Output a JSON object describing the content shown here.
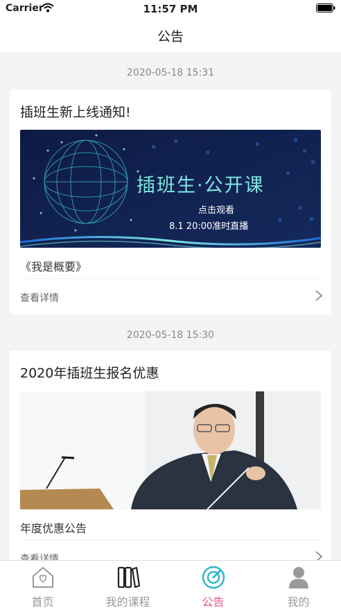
{
  "status_bar": {
    "carrier": "Carrier",
    "time": "11:57 PM"
  },
  "nav": {
    "title": "公告"
  },
  "colors": {
    "accent": "#e8547f",
    "active_icon": "#2bb7c8",
    "inactive": "#999999"
  },
  "announcements": [
    {
      "timestamp": "2020-05-18 15:31",
      "title": "插班生新上线通知!",
      "banner": {
        "line1": "插班生·公开课",
        "line2": "点击观看",
        "line3": "8.1 20:00准时直播"
      },
      "subtitle": "《我是概要》",
      "detail_label": "查看详情"
    },
    {
      "timestamp": "2020-05-18 15:30",
      "title": "2020年插班生报名优惠",
      "subtitle": "年度优惠公告",
      "detail_label": "查看详情"
    }
  ],
  "tabs": [
    {
      "label": "首页",
      "icon": "home-icon",
      "active": false
    },
    {
      "label": "我的课程",
      "icon": "books-icon",
      "active": false
    },
    {
      "label": "公告",
      "icon": "announcement-icon",
      "active": true
    },
    {
      "label": "我的",
      "icon": "user-icon",
      "active": false
    }
  ]
}
